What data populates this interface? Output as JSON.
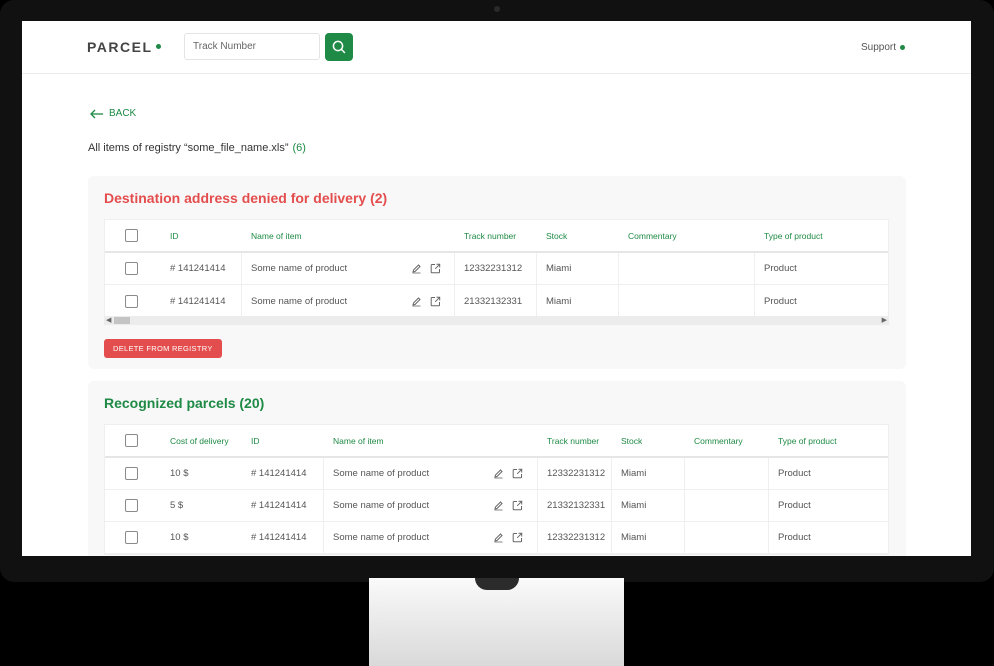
{
  "header": {
    "logo": "PARCEL",
    "search_placeholder": "Track Number",
    "support": "Support"
  },
  "back_label": "BACK",
  "registry": {
    "title": "All items of registry “some_file_name.xls”",
    "count": "(6)"
  },
  "denied": {
    "title": "Destination address denied for delivery (2)",
    "columns": [
      "ID",
      "Name of item",
      "Track number",
      "Stock",
      "Commentary",
      "Type of product"
    ],
    "rows": [
      {
        "id": "# 141241414",
        "name": "Some name of product",
        "track": "12332231312",
        "stock": "Miami",
        "comment": "",
        "type": "Product"
      },
      {
        "id": "# 141241414",
        "name": "Some name of product",
        "track": "21332132331",
        "stock": "Miami",
        "comment": "",
        "type": "Product"
      }
    ],
    "delete_label": "DELETE FROM REGISTRY"
  },
  "recognized": {
    "title": "Recognized parcels (20)",
    "columns": [
      "Cost of delivery",
      "ID",
      "Name of item",
      "Track number",
      "Stock",
      "Commentary",
      "Type of product"
    ],
    "rows": [
      {
        "cost": "10 $",
        "id": "# 141241414",
        "name": "Some name of product",
        "track": "12332231312",
        "stock": "Miami",
        "comment": "",
        "type": "Product"
      },
      {
        "cost": "5 $",
        "id": "# 141241414",
        "name": "Some name of product",
        "track": "21332132331",
        "stock": "Miami",
        "comment": "",
        "type": "Product"
      },
      {
        "cost": "10 $",
        "id": "# 141241414",
        "name": "Some name of product",
        "track": "12332231312",
        "stock": "Miami",
        "comment": "",
        "type": "Product"
      }
    ]
  },
  "colors": {
    "accent": "#1e8a45",
    "danger": "#e44d4d"
  }
}
